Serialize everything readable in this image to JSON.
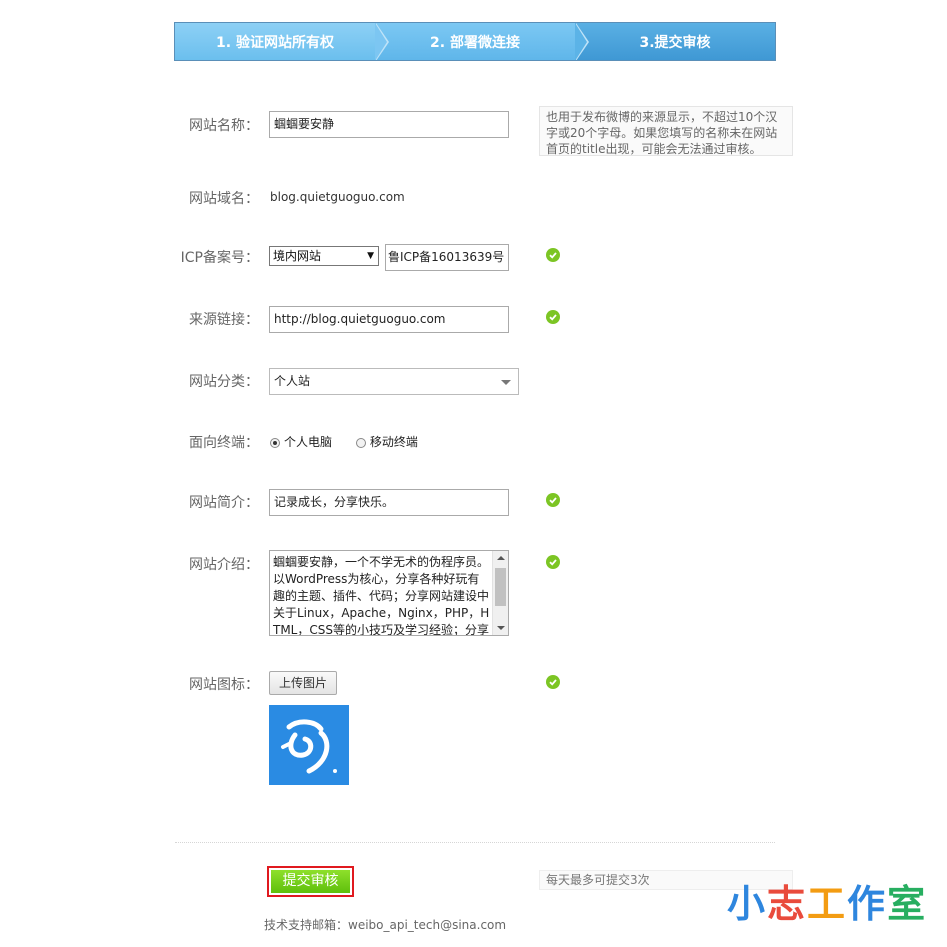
{
  "steps": [
    "1. 验证网站所有权",
    "2. 部署微连接",
    "3.提交审核"
  ],
  "form": {
    "name": {
      "label": "网站名称：",
      "value": "蝈蝈要安静",
      "hint": "也用于发布微博的来源显示，不超过10个汉字或20个字母。如果您填写的名称未在网站首页的title出现，可能会无法通过审核。"
    },
    "domain": {
      "label": "网站域名：",
      "value": "blog.quietguoguo.com"
    },
    "icp": {
      "label": "ICP备案号：",
      "type_value": "境内网站",
      "value": "鲁ICP备16013639号"
    },
    "source": {
      "label": "来源链接：",
      "value": "http://blog.quietguoguo.com"
    },
    "category": {
      "label": "网站分类：",
      "value": "个人站"
    },
    "terminal": {
      "label": "面向终端：",
      "options": [
        "个人电脑",
        "移动终端"
      ],
      "selected": "个人电脑"
    },
    "summary": {
      "label": "网站简介：",
      "value": "记录成长，分享快乐。"
    },
    "intro": {
      "label": "网站介绍：",
      "value": "蝈蝈要安静，一个不学无术的伪程序员。以WordPress为核心，分享各种好玩有趣的主题、插件、代码；分享网站建设中关于Linux，Apache，Nginx，PHP，HTML，CSS等的小技巧及学习经验；分享Windows、网站开发运维使用的一些小技巧、分享"
    },
    "icon": {
      "label": "网站图标：",
      "upload_label": "上传图片"
    }
  },
  "submit": {
    "label": "提交审核",
    "note": "每天最多可提交3次"
  },
  "footer": "技术支持邮箱：weibo_api_tech@sina.com",
  "watermark": {
    "chars": [
      "小",
      "志",
      "工",
      "作",
      "室"
    ],
    "colors": [
      "#2e86de",
      "#e94b3c",
      "#f39c12",
      "#2e86de",
      "#27ae60"
    ]
  },
  "colors": {
    "accent_green": "#7cc524",
    "step_blue": "#4aa3dc",
    "submit_border": "#e0191f"
  }
}
